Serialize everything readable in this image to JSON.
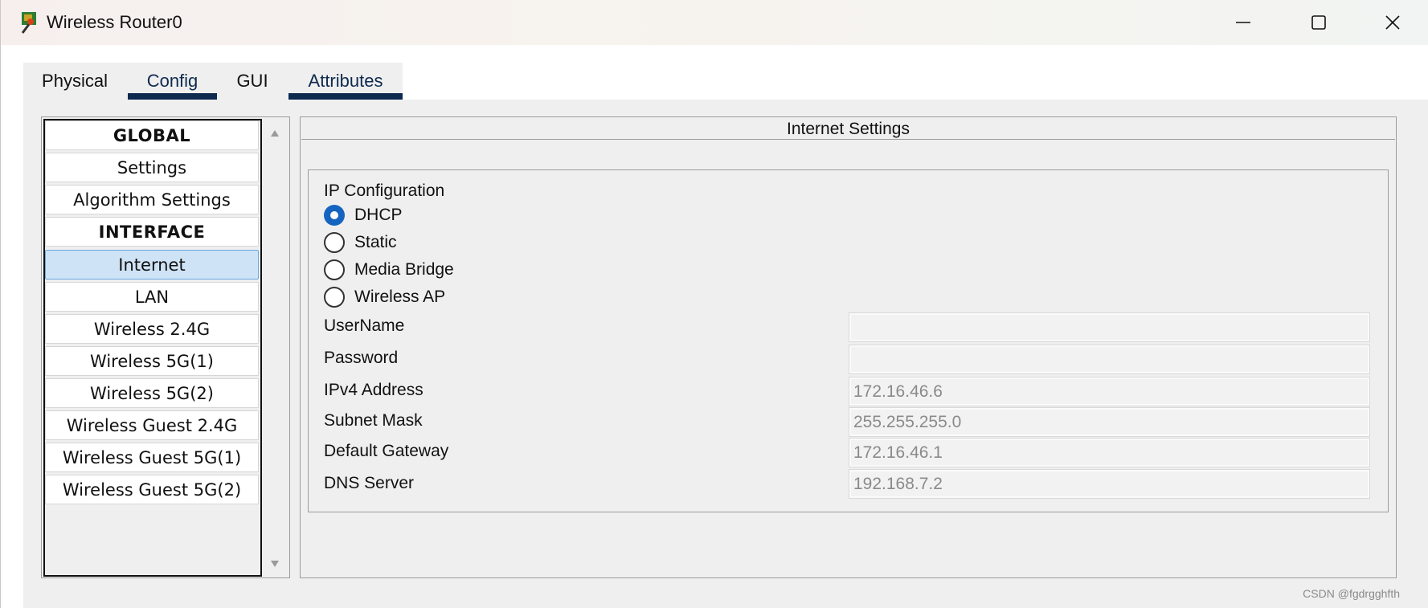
{
  "window": {
    "title": "Wireless Router0"
  },
  "tabs": [
    {
      "label": "Physical",
      "active": false
    },
    {
      "label": "Config",
      "active": true
    },
    {
      "label": "GUI",
      "active": false
    },
    {
      "label": "Attributes",
      "active": false
    }
  ],
  "sidebar": {
    "items": [
      {
        "label": "GLOBAL",
        "type": "header"
      },
      {
        "label": "Settings",
        "type": "item"
      },
      {
        "label": "Algorithm Settings",
        "type": "item"
      },
      {
        "label": "INTERFACE",
        "type": "header"
      },
      {
        "label": "Internet",
        "type": "item",
        "selected": true
      },
      {
        "label": "LAN",
        "type": "item"
      },
      {
        "label": "Wireless 2.4G",
        "type": "item"
      },
      {
        "label": "Wireless 5G(1)",
        "type": "item"
      },
      {
        "label": "Wireless 5G(2)",
        "type": "item"
      },
      {
        "label": "Wireless Guest 2.4G",
        "type": "item"
      },
      {
        "label": "Wireless Guest 5G(1)",
        "type": "item"
      },
      {
        "label": "Wireless Guest 5G(2)",
        "type": "item"
      }
    ]
  },
  "panel": {
    "title": "Internet Settings",
    "ip_config_label": "IP Configuration",
    "radios": [
      {
        "label": "DHCP",
        "checked": true
      },
      {
        "label": "Static",
        "checked": false
      },
      {
        "label": "Media Bridge",
        "checked": false
      },
      {
        "label": "Wireless AP",
        "checked": false
      }
    ],
    "fields": [
      {
        "label": "UserName",
        "value": ""
      },
      {
        "label": "Password",
        "value": ""
      },
      {
        "label": "IPv4 Address",
        "value": "172.16.46.6"
      },
      {
        "label": "Subnet Mask",
        "value": "255.255.255.0"
      },
      {
        "label": "Default Gateway",
        "value": "172.16.46.1"
      },
      {
        "label": "DNS Server",
        "value": "192.168.7.2"
      }
    ]
  },
  "watermark": "CSDN @fgdrgghfth",
  "colors": {
    "accent": "#0e2a4f",
    "selected_bg": "#cfe3f6",
    "radio_checked": "#1565c0"
  }
}
